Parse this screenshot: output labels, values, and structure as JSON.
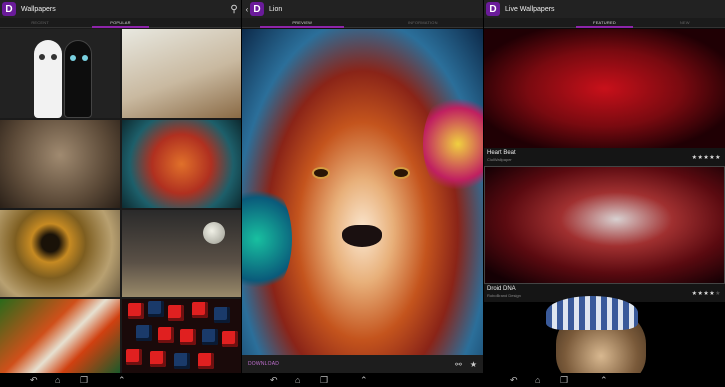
{
  "panel_gallery": {
    "title": "Wallpapers",
    "tabs": [
      "RECENT",
      "POPULAR",
      ""
    ],
    "active_tab": 1,
    "thumbnails": [
      "cats",
      "squirrel",
      "elephant",
      "lion",
      "eye",
      "moon-landscape",
      "clownfish",
      "red-cubes"
    ]
  },
  "panel_detail": {
    "title": "Lion",
    "tabs": [
      "PREVIEW",
      "INFORMATION"
    ],
    "active_tab": 0,
    "download_label": "DOWNLOAD"
  },
  "panel_live": {
    "title": "Live Wallpapers",
    "tabs": [
      "",
      "FEATURED",
      "NEW"
    ],
    "active_tab": 1,
    "items": [
      {
        "name": "Heart Beat",
        "author": "CiulWallpaper",
        "rating": 5
      },
      {
        "name": "Droid DNA",
        "author": "RoboBrand Design",
        "rating": 4
      },
      {
        "name": "",
        "author": "",
        "rating": 0
      }
    ]
  },
  "colors": {
    "accent": "#8e24aa",
    "actionbar": "#222222",
    "navbar": "#000000"
  },
  "icons": [
    "search-icon",
    "share-icon",
    "star-icon",
    "back-icon",
    "home-icon",
    "recent-apps-icon",
    "screenshot-icon",
    "up-arrow-icon"
  ]
}
